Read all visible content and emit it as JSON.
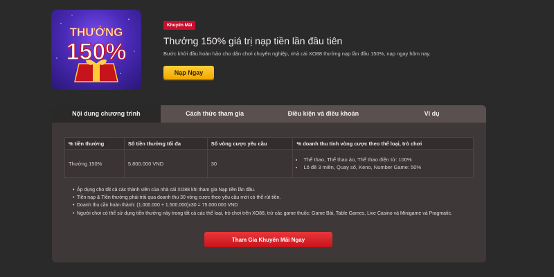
{
  "promo": {
    "image_text_top": "THƯỞNG",
    "image_text_main": "150%",
    "badge": "Khuyến Mãi",
    "title": "Thưởng 150% giá trị nạp tiền lần đầu tiên",
    "description": "Bước khởi đầu hoàn hảo cho dân chơi chuyên nghiệp, nhà cái XO88 thưởng nạp lần đầu 150%, nạp ngay hôm nay.",
    "cta_label": "Nạp Ngay"
  },
  "tabs": [
    {
      "label": "Nội dung chương trình",
      "active": true
    },
    {
      "label": "Cách thức tham gia",
      "active": false
    },
    {
      "label": "Điều kiện và điều khoản",
      "active": false
    },
    {
      "label": "Ví dụ",
      "active": false
    }
  ],
  "table": {
    "headers": [
      "% tiền thưởng",
      "Số tiền thưởng tối đa",
      "Số vòng cược yêu cầu",
      "% doanh thu tính vòng cược theo thể loại, trò chơi"
    ],
    "row": {
      "bonus_percent": "Thưởng 150%",
      "max_bonus": "5.800.000 VND",
      "rounds": "30",
      "turnover": [
        "Thể thao, Thể thao ảo, Thể thao điện tử: 100%",
        "Lô đề 3 miền, Quay số, Keno, Number Game: 50%"
      ]
    }
  },
  "notes": [
    "Áp dụng cho tất cả các thành viên của nhà cái XO88 khi tham gia Nạp tiền lần đầu.",
    "Tiền nạp & Tiền thưởng phải trải qua doanh thu 30 vòng cược theo yêu cầu mới có thể rút tiền.",
    "Doanh thu cần hoàn thành: (1.000.000 + 1.500.000)x30 = 75.000.000 VND",
    "Người chơi có thể sử dụng tiền thưởng này trong tất cả các thể loại, trò chơi trên XO88, trừ các game thuộc: Game Bài, Table Games, Live Casino và Minigame và Pragmatic."
  ],
  "join_label": "Tham Gia Khuyến Mãi Ngay",
  "colors": {
    "background": "#2b2a2a",
    "panel": "#3e3838",
    "tab_bar": "#5a504f",
    "badge_red": "#c8102e",
    "gold_button": "#f2a900",
    "red_button": "#d8222a"
  }
}
